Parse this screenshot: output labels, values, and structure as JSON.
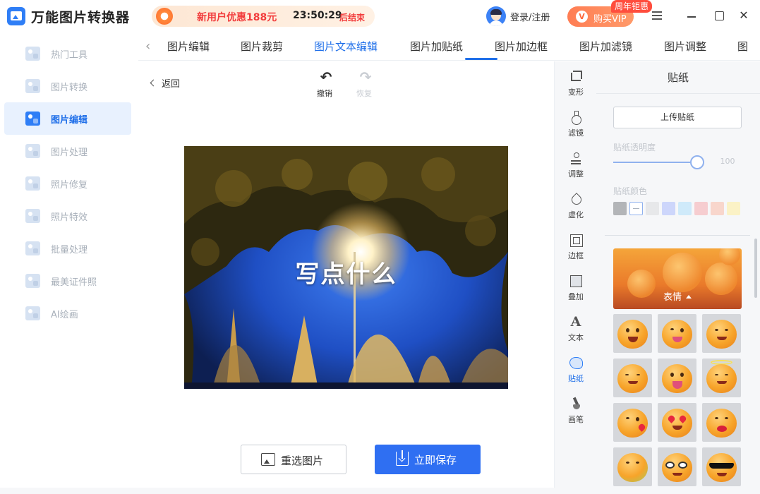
{
  "app": {
    "title": "万能图片转换器"
  },
  "promo": {
    "text": "新用户优惠188元",
    "countdown": "23:50:29",
    "end_label": "后结束"
  },
  "account": {
    "login_label": "登录/注册"
  },
  "vip": {
    "button_label": "购买VIP",
    "badge": "周年钜惠",
    "icon_glyph": "V"
  },
  "window": {
    "close_glyph": "✕"
  },
  "sidebar": {
    "items": [
      {
        "label": "热门工具",
        "active": false
      },
      {
        "label": "图片转换",
        "active": false
      },
      {
        "label": "图片编辑",
        "active": true
      },
      {
        "label": "图片处理",
        "active": false
      },
      {
        "label": "照片修复",
        "active": false
      },
      {
        "label": "照片特效",
        "active": false
      },
      {
        "label": "批量处理",
        "active": false
      },
      {
        "label": "最美证件照",
        "active": false
      },
      {
        "label": "AI绘画",
        "active": false
      }
    ]
  },
  "tabs": {
    "prev_glyph": "‹",
    "items": [
      {
        "label": "图片编辑",
        "active": false
      },
      {
        "label": "图片裁剪",
        "active": false
      },
      {
        "label": "图片文本编辑",
        "active": true
      },
      {
        "label": "图片加贴纸",
        "active": false
      },
      {
        "label": "图片加边框",
        "active": false
      },
      {
        "label": "图片加滤镜",
        "active": false
      },
      {
        "label": "图片调整",
        "active": false
      },
      {
        "label": "图",
        "active": false
      }
    ]
  },
  "editor": {
    "back_label": "返回",
    "undo_label": "撤销",
    "redo_label": "恢复",
    "undo_glyph": "↶",
    "redo_glyph": "↷",
    "canvas_text": "写点什么",
    "reselect_label": "重选图片",
    "save_label": "立即保存"
  },
  "tools": {
    "items": [
      {
        "label": "变形",
        "icon": "crop-icon",
        "active": false
      },
      {
        "label": "滤镜",
        "icon": "flask-icon",
        "active": false
      },
      {
        "label": "调整",
        "icon": "adjust-icon",
        "active": false
      },
      {
        "label": "虚化",
        "icon": "drop-icon",
        "active": false
      },
      {
        "label": "边框",
        "icon": "frame-icon",
        "active": false
      },
      {
        "label": "叠加",
        "icon": "overlay-icon",
        "active": false
      },
      {
        "label": "文本",
        "icon": "text-icon",
        "active": false
      },
      {
        "label": "贴纸",
        "icon": "sticker-icon",
        "active": true
      },
      {
        "label": "画笔",
        "icon": "brush-icon",
        "active": false
      }
    ],
    "text_glyph": "A"
  },
  "panel": {
    "title": "贴纸",
    "upload_label": "上传贴纸",
    "opacity_label": "贴纸透明度",
    "opacity_value": "100",
    "opacity_fraction": 1.0,
    "color_label": "贴纸颜色",
    "colors": [
      "#b3b5b8",
      "#ffffff",
      "#e7e8ea",
      "#cdd6fb",
      "#cfeafa",
      "#f6cdd0",
      "#f8d6cc",
      "#fbf2c6"
    ],
    "selected_color_index": 1,
    "category_label": "表情"
  },
  "accent_color": "#1f6fe9"
}
